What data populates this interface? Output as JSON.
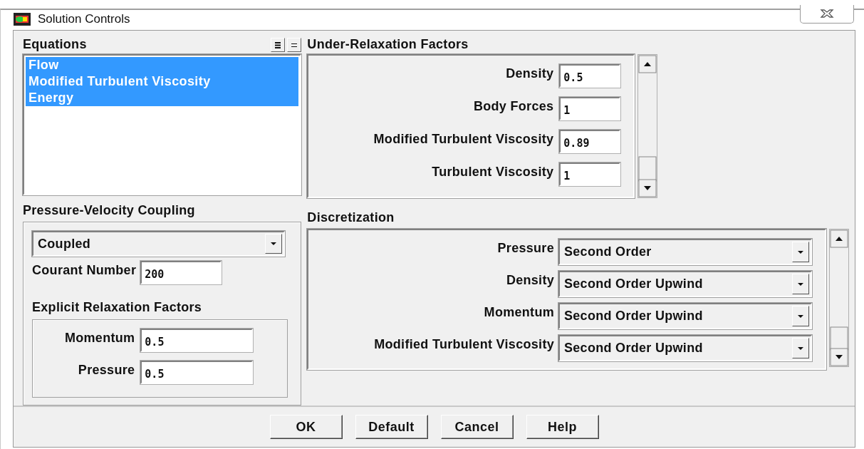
{
  "window": {
    "title": "Solution Controls"
  },
  "equations": {
    "title": "Equations",
    "items": [
      {
        "label": "Flow",
        "selected": true
      },
      {
        "label": "Modified Turbulent Viscosity",
        "selected": true
      },
      {
        "label": "Energy",
        "selected": true
      }
    ]
  },
  "pressure_velocity_coupling": {
    "title": "Pressure-Velocity Coupling",
    "scheme": "Coupled",
    "courant_label": "Courant Number",
    "courant_value": "200",
    "explicit_title": "Explicit Relaxation Factors",
    "explicit_fields": [
      {
        "label": "Momentum",
        "value": "0.5"
      },
      {
        "label": "Pressure",
        "value": "0.5"
      }
    ]
  },
  "under_relaxation": {
    "title": "Under-Relaxation Factors",
    "fields": [
      {
        "label": "Density",
        "value": "0.5"
      },
      {
        "label": "Body Forces",
        "value": "1"
      },
      {
        "label": "Modified Turbulent Viscosity",
        "value": "0.89"
      },
      {
        "label": "Turbulent Viscosity",
        "value": "1"
      }
    ]
  },
  "discretization": {
    "title": "Discretization",
    "fields": [
      {
        "label": "Pressure",
        "value": "Second Order"
      },
      {
        "label": "Density",
        "value": "Second Order Upwind"
      },
      {
        "label": "Momentum",
        "value": "Second Order Upwind"
      },
      {
        "label": "Modified Turbulent Viscosity",
        "value": "Second Order Upwind"
      }
    ]
  },
  "buttons": [
    "OK",
    "Default",
    "Cancel",
    "Help"
  ]
}
